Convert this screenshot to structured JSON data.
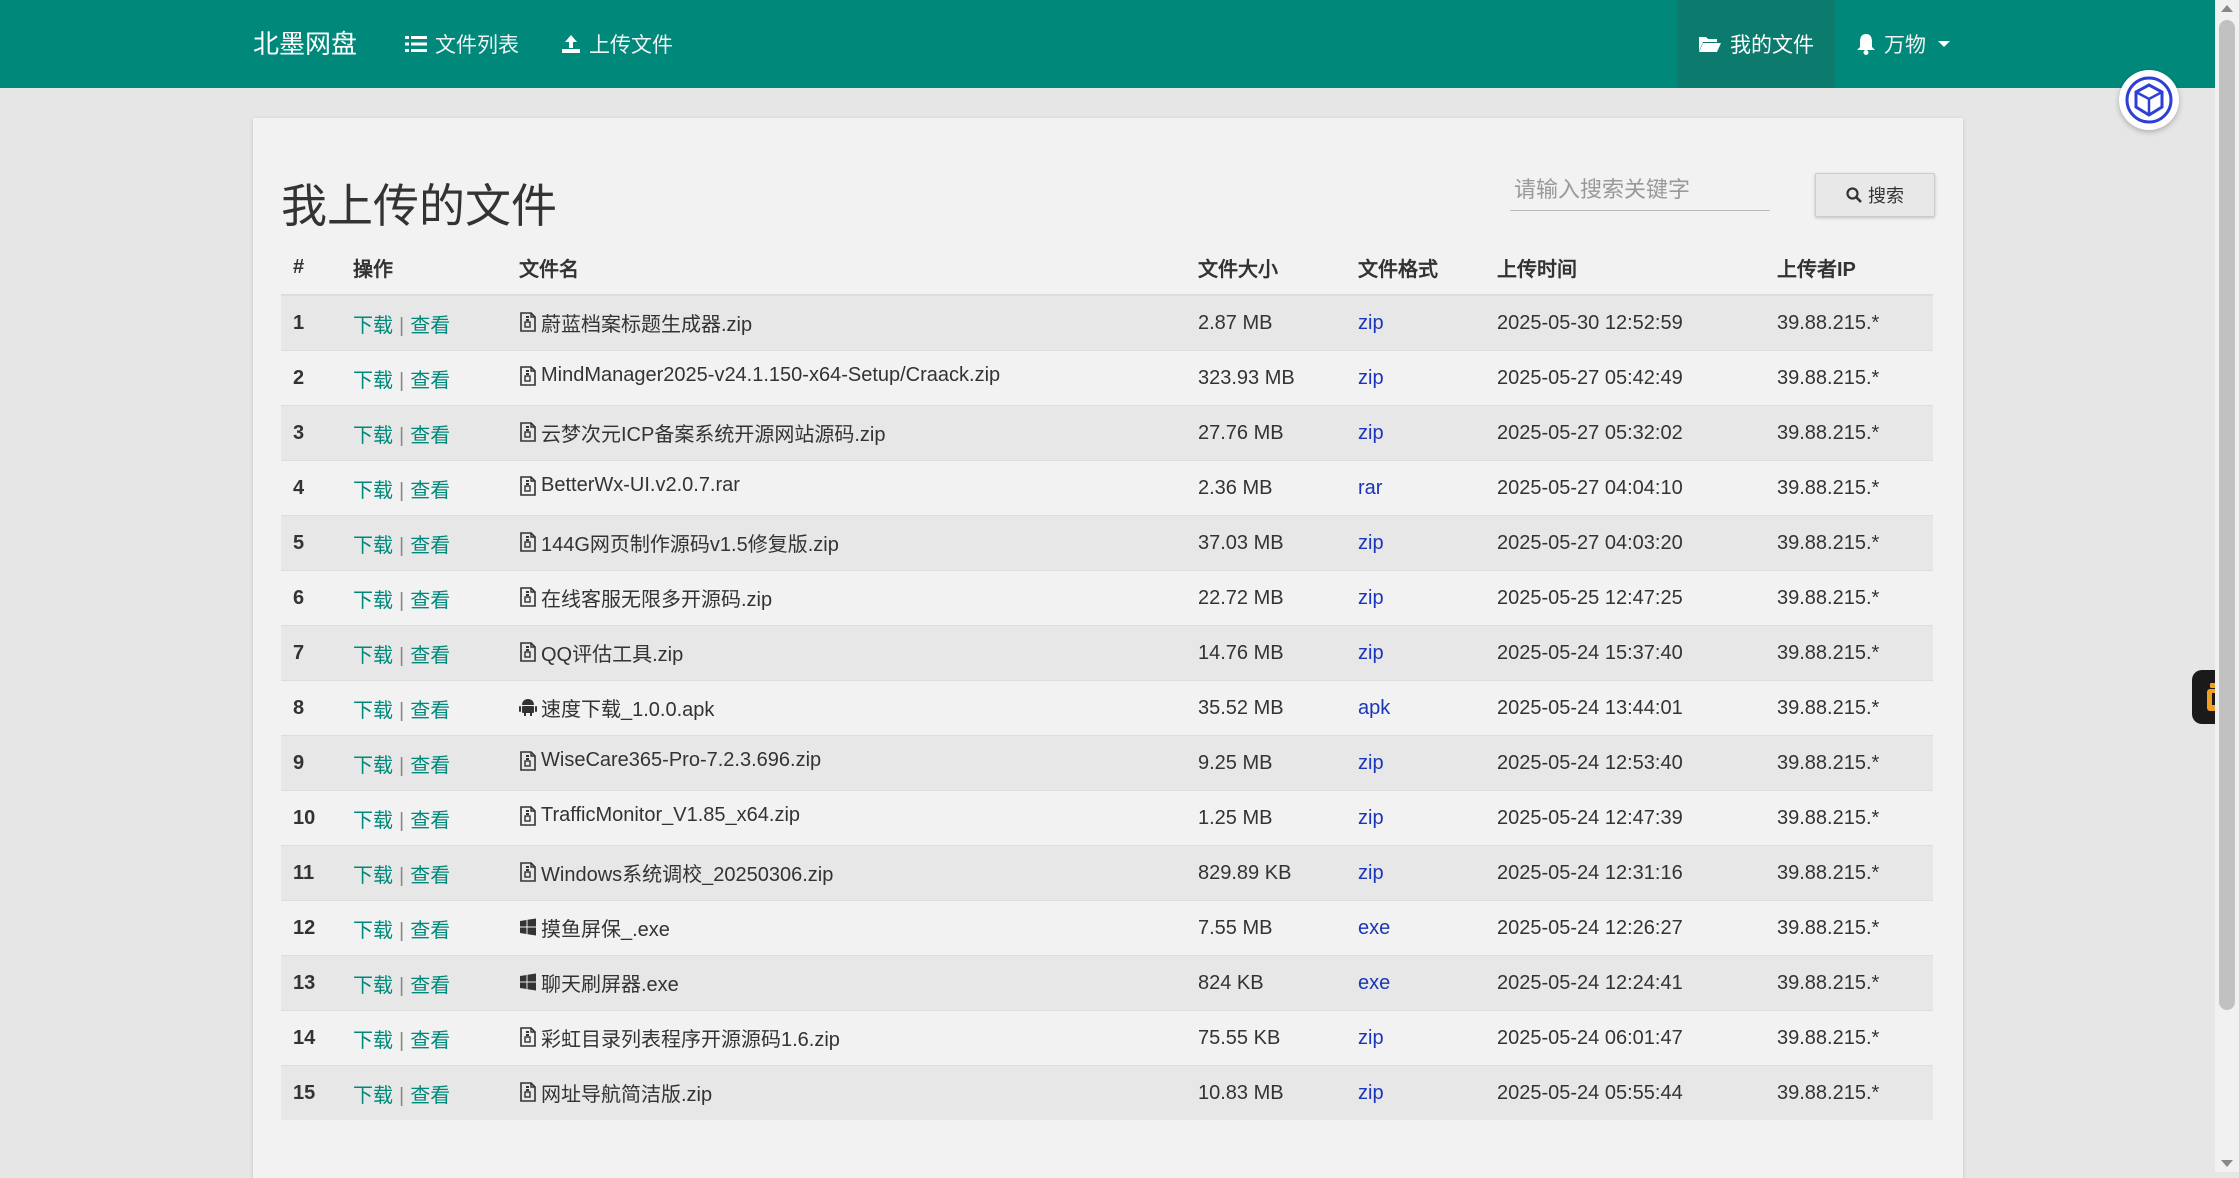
{
  "nav": {
    "brand": "北墨网盘",
    "file_list": "文件列表",
    "upload": "上传文件",
    "my_files": "我的文件",
    "user": "万物"
  },
  "page": {
    "title": "我上传的文件",
    "search_placeholder": "请输入搜索关键字",
    "search_button": "搜索"
  },
  "table": {
    "headers": [
      "#",
      "操作",
      "文件名",
      "文件大小",
      "文件格式",
      "上传时间",
      "上传者IP"
    ],
    "action_download": "下载",
    "action_view": "查看",
    "rows": [
      {
        "n": "1",
        "icon": "file-zip-icon",
        "name": "蔚蓝档案标题生成器.zip",
        "size": "2.87 MB",
        "fmt": "zip",
        "time": "2025-05-30 12:52:59",
        "ip": "39.88.215.*"
      },
      {
        "n": "2",
        "icon": "file-zip-icon",
        "name": "MindManager2025-v24.1.150-x64-Setup/Craack.zip",
        "size": "323.93 MB",
        "fmt": "zip",
        "time": "2025-05-27 05:42:49",
        "ip": "39.88.215.*"
      },
      {
        "n": "3",
        "icon": "file-zip-icon",
        "name": "云梦次元ICP备案系统开源网站源码.zip",
        "size": "27.76 MB",
        "fmt": "zip",
        "time": "2025-05-27 05:32:02",
        "ip": "39.88.215.*"
      },
      {
        "n": "4",
        "icon": "file-zip-icon",
        "name": "BetterWx-UI.v2.0.7.rar",
        "size": "2.36 MB",
        "fmt": "rar",
        "time": "2025-05-27 04:04:10",
        "ip": "39.88.215.*"
      },
      {
        "n": "5",
        "icon": "file-zip-icon",
        "name": "144G网页制作源码v1.5修复版.zip",
        "size": "37.03 MB",
        "fmt": "zip",
        "time": "2025-05-27 04:03:20",
        "ip": "39.88.215.*"
      },
      {
        "n": "6",
        "icon": "file-zip-icon",
        "name": "在线客服无限多开源码.zip",
        "size": "22.72 MB",
        "fmt": "zip",
        "time": "2025-05-25 12:47:25",
        "ip": "39.88.215.*"
      },
      {
        "n": "7",
        "icon": "file-zip-icon",
        "name": "QQ评估工具.zip",
        "size": "14.76 MB",
        "fmt": "zip",
        "time": "2025-05-24 15:37:40",
        "ip": "39.88.215.*"
      },
      {
        "n": "8",
        "icon": "android-icon",
        "name": "速度下载_1.0.0.apk",
        "size": "35.52 MB",
        "fmt": "apk",
        "time": "2025-05-24 13:44:01",
        "ip": "39.88.215.*"
      },
      {
        "n": "9",
        "icon": "file-zip-icon",
        "name": "WiseCare365-Pro-7.2.3.696.zip",
        "size": "9.25 MB",
        "fmt": "zip",
        "time": "2025-05-24 12:53:40",
        "ip": "39.88.215.*"
      },
      {
        "n": "10",
        "icon": "file-zip-icon",
        "name": "TrafficMonitor_V1.85_x64.zip",
        "size": "1.25 MB",
        "fmt": "zip",
        "time": "2025-05-24 12:47:39",
        "ip": "39.88.215.*"
      },
      {
        "n": "11",
        "icon": "file-zip-icon",
        "name": "Windows系统调校_20250306.zip",
        "size": "829.89 KB",
        "fmt": "zip",
        "time": "2025-05-24 12:31:16",
        "ip": "39.88.215.*"
      },
      {
        "n": "12",
        "icon": "windows-icon",
        "name": "摸鱼屏保_.exe",
        "size": "7.55 MB",
        "fmt": "exe",
        "time": "2025-05-24 12:26:27",
        "ip": "39.88.215.*"
      },
      {
        "n": "13",
        "icon": "windows-icon",
        "name": "聊天刷屏器.exe",
        "size": "824 KB",
        "fmt": "exe",
        "time": "2025-05-24 12:24:41",
        "ip": "39.88.215.*"
      },
      {
        "n": "14",
        "icon": "file-zip-icon",
        "name": "彩虹目录列表程序开源源码1.6.zip",
        "size": "75.55 KB",
        "fmt": "zip",
        "time": "2025-05-24 06:01:47",
        "ip": "39.88.215.*"
      },
      {
        "n": "15",
        "icon": "file-zip-icon",
        "name": "网址导航简洁版.zip",
        "size": "10.83 MB",
        "fmt": "zip",
        "time": "2025-05-24 05:55:44",
        "ip": "39.88.215.*"
      }
    ]
  },
  "colors": {
    "navbar": "#00897b",
    "action_link": "#00897b",
    "format_link": "#1a35b8"
  }
}
